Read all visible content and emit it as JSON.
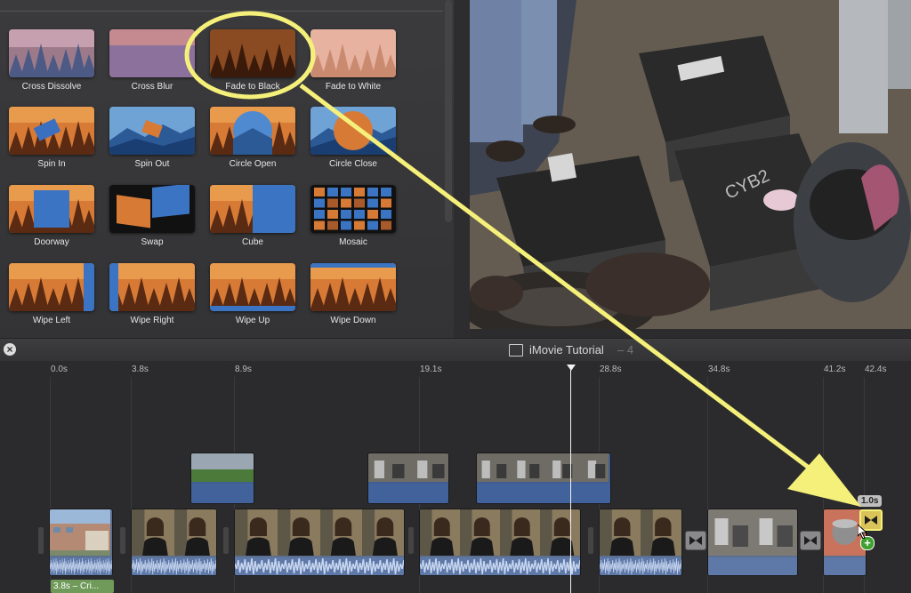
{
  "transitions": [
    {
      "label": "Cross Dissolve",
      "style": "dissolve"
    },
    {
      "label": "Cross Blur",
      "style": "blur"
    },
    {
      "label": "Fade to Black",
      "style": "fade"
    },
    {
      "label": "Fade to White",
      "style": "white"
    },
    {
      "label": "Spin In",
      "style": "spinin"
    },
    {
      "label": "Spin Out",
      "style": "spinout"
    },
    {
      "label": "Circle Open",
      "style": "circleopen"
    },
    {
      "label": "Circle Close",
      "style": "circleclose"
    },
    {
      "label": "Doorway",
      "style": "doorway"
    },
    {
      "label": "Swap",
      "style": "swap"
    },
    {
      "label": "Cube",
      "style": "cube"
    },
    {
      "label": "Mosaic",
      "style": "mosaic"
    },
    {
      "label": "Wipe Left",
      "style": "wipeleft"
    },
    {
      "label": "Wipe Right",
      "style": "wiperight"
    },
    {
      "label": "Wipe Up",
      "style": "wipeup"
    },
    {
      "label": "Wipe Down",
      "style": "wipedown"
    }
  ],
  "timeline": {
    "project_title": "iMovie Tutorial",
    "duration_partial": "– 4",
    "ticks": [
      "0.0s",
      "3.8s",
      "8.9s",
      "19.1s",
      "28.8s",
      "34.8s",
      "41.2s",
      "42.4s"
    ],
    "transition_duration": "1.0s",
    "title_clip_label": "3.8s – Cri..."
  },
  "colors": {
    "highlight_yellow": "#f5f07a",
    "audio_blue": "#5e79a8",
    "title_green": "#6f9a5a"
  }
}
